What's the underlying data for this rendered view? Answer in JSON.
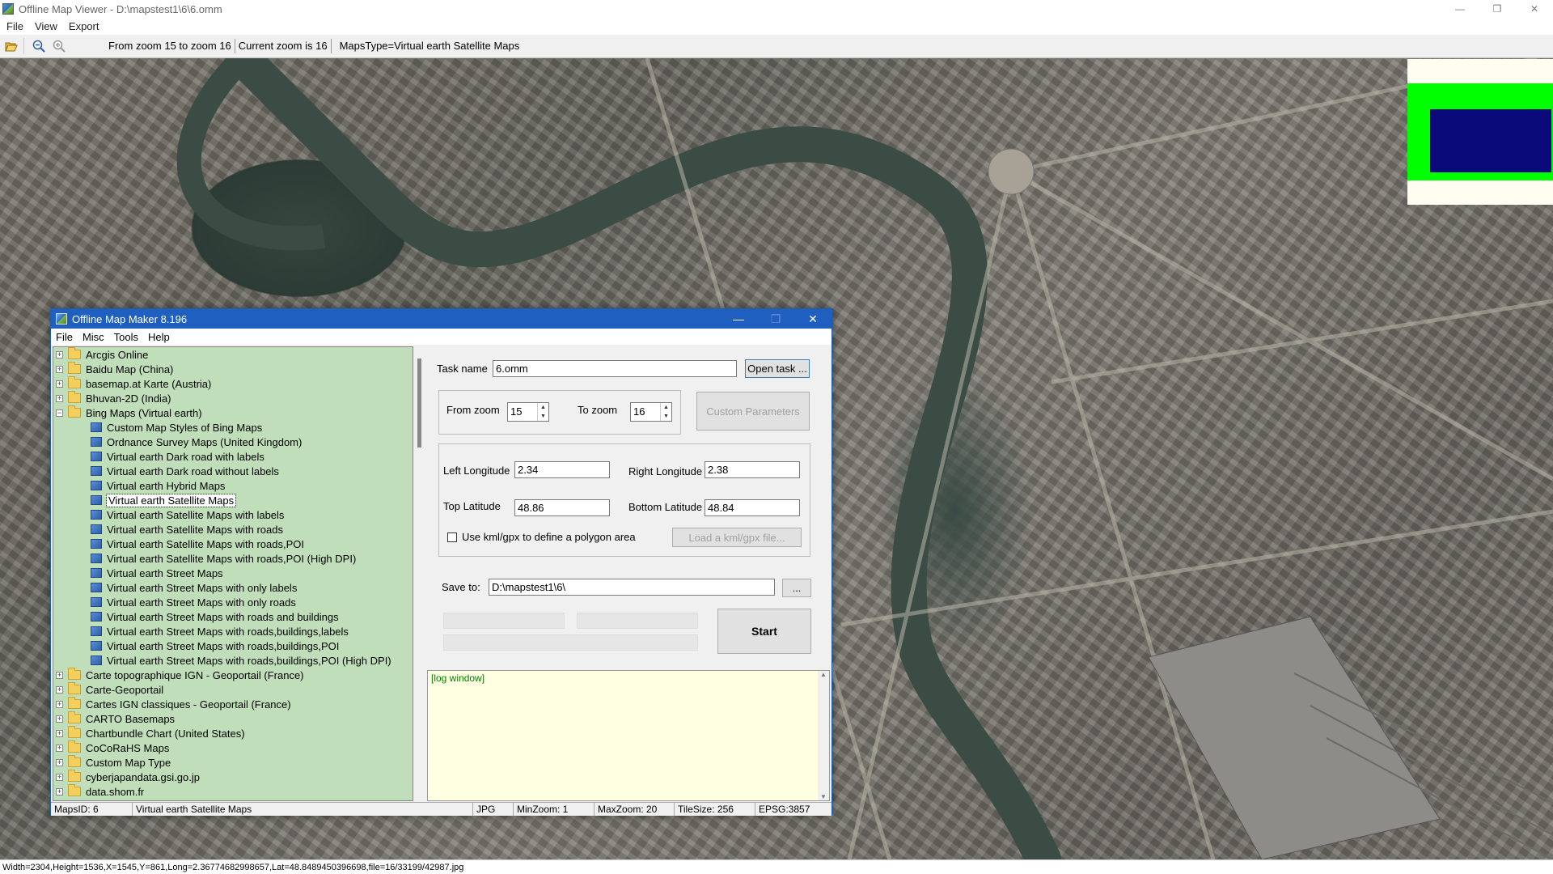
{
  "viewer": {
    "title": "Offline Map Viewer - D:\\mapstest1\\6\\6.omm",
    "window_controls": {
      "minimize": "—",
      "restore": "❐",
      "close": "✕"
    },
    "menu": [
      "File",
      "View",
      "Export"
    ],
    "toolbar_status": {
      "zoom_range": "From zoom 15 to zoom 16",
      "current_zoom": "Current zoom is 16",
      "maps_type": "MapsType=Virtual earth Satellite Maps"
    },
    "status_bar": "Width=2304,Height=1536,X=1545,Y=861,Long=2.36774682998657,Lat=48.8489450396698,file=16/33199/42987.jpg"
  },
  "maker": {
    "title": "Offline Map Maker 8.196",
    "menu": [
      "File",
      "Misc",
      "Tools",
      "Help"
    ],
    "tree": [
      {
        "label": "Arcgis Online",
        "type": "folder",
        "expanded": false
      },
      {
        "label": "Baidu Map (China)",
        "type": "folder",
        "expanded": false
      },
      {
        "label": "basemap.at Karte (Austria)",
        "type": "folder",
        "expanded": false
      },
      {
        "label": "Bhuvan-2D (India)",
        "type": "folder",
        "expanded": false
      },
      {
        "label": "Bing Maps (Virtual earth)",
        "type": "folder",
        "expanded": true
      },
      {
        "label": "Custom Map Styles of Bing Maps",
        "type": "leaf"
      },
      {
        "label": "Ordnance Survey Maps (United Kingdom)",
        "type": "leaf"
      },
      {
        "label": "Virtual earth Dark road with labels",
        "type": "leaf"
      },
      {
        "label": "Virtual earth Dark road without labels",
        "type": "leaf"
      },
      {
        "label": "Virtual earth Hybrid Maps",
        "type": "leaf"
      },
      {
        "label": "Virtual earth Satellite Maps",
        "type": "leaf",
        "selected": true
      },
      {
        "label": "Virtual earth Satellite Maps with labels",
        "type": "leaf"
      },
      {
        "label": "Virtual earth Satellite Maps with roads",
        "type": "leaf"
      },
      {
        "label": "Virtual earth Satellite Maps with roads,POI",
        "type": "leaf"
      },
      {
        "label": "Virtual earth Satellite Maps with roads,POI (High DPI)",
        "type": "leaf"
      },
      {
        "label": "Virtual earth Street Maps",
        "type": "leaf"
      },
      {
        "label": "Virtual earth Street Maps with only labels",
        "type": "leaf"
      },
      {
        "label": "Virtual earth Street Maps with only roads",
        "type": "leaf"
      },
      {
        "label": "Virtual earth Street Maps with roads and buildings",
        "type": "leaf"
      },
      {
        "label": "Virtual earth Street Maps with roads,buildings,labels",
        "type": "leaf"
      },
      {
        "label": "Virtual earth Street Maps with roads,buildings,POI",
        "type": "leaf"
      },
      {
        "label": "Virtual earth Street Maps with roads,buildings,POI (High DPI)",
        "type": "leaf"
      },
      {
        "label": "Carte topographique IGN - Geoportail (France)",
        "type": "folder",
        "expanded": false
      },
      {
        "label": "Carte-Geoportail",
        "type": "folder",
        "expanded": false
      },
      {
        "label": "Cartes IGN classiques - Geoportail (France)",
        "type": "folder",
        "expanded": false
      },
      {
        "label": "CARTO Basemaps",
        "type": "folder",
        "expanded": false
      },
      {
        "label": "Chartbundle Chart (United States)",
        "type": "folder",
        "expanded": false
      },
      {
        "label": "CoCoRaHS Maps",
        "type": "folder",
        "expanded": false
      },
      {
        "label": "Custom Map Type",
        "type": "folder",
        "expanded": false
      },
      {
        "label": "cyberjapandata.gsi.go.jp",
        "type": "folder",
        "expanded": false
      },
      {
        "label": "data.shom.fr",
        "type": "folder",
        "expanded": false
      }
    ],
    "form": {
      "task_name_label": "Task name",
      "task_name_value": "6.omm",
      "open_task_button": "Open task ...",
      "from_zoom_label": "From zoom",
      "from_zoom_value": "15",
      "to_zoom_label": "To zoom",
      "to_zoom_value": "16",
      "custom_params_button": "Custom Parameters",
      "left_lon_label": "Left Longitude",
      "left_lon_value": "2.34",
      "right_lon_label": "Right Longitude",
      "right_lon_value": "2.38",
      "top_lat_label": "Top Latitude",
      "top_lat_value": "48.86",
      "bottom_lat_label": "Bottom Latitude",
      "bottom_lat_value": "48.84",
      "kml_checkbox_label": "Use kml/gpx to define a polygon area",
      "kml_checked": false,
      "load_kml_button": "Load a kml/gpx file...",
      "save_to_label": "Save to:",
      "save_to_value": "D:\\mapstest1\\6\\",
      "browse_button": "...",
      "start_button": "Start"
    },
    "log_text": "[log window]",
    "status": {
      "maps_id": "MapsID: 6",
      "maps_name": "Virtual earth Satellite Maps",
      "format": "JPG",
      "min_zoom": "MinZoom: 1",
      "max_zoom": "MaxZoom: 20",
      "tile_size": "TileSize: 256",
      "epsg": "EPSG:3857"
    }
  },
  "colors": {
    "tree_bg": "#c1deba",
    "log_bg": "#ffffe1",
    "maker_title_bg": "#1f5fbf",
    "minimap_frame": "#00ff00",
    "minimap_view": "#0a0a7a"
  },
  "icons": {
    "open": "folder-open-icon",
    "zoom_out": "zoom-out-icon",
    "zoom_in": "zoom-in-icon"
  }
}
